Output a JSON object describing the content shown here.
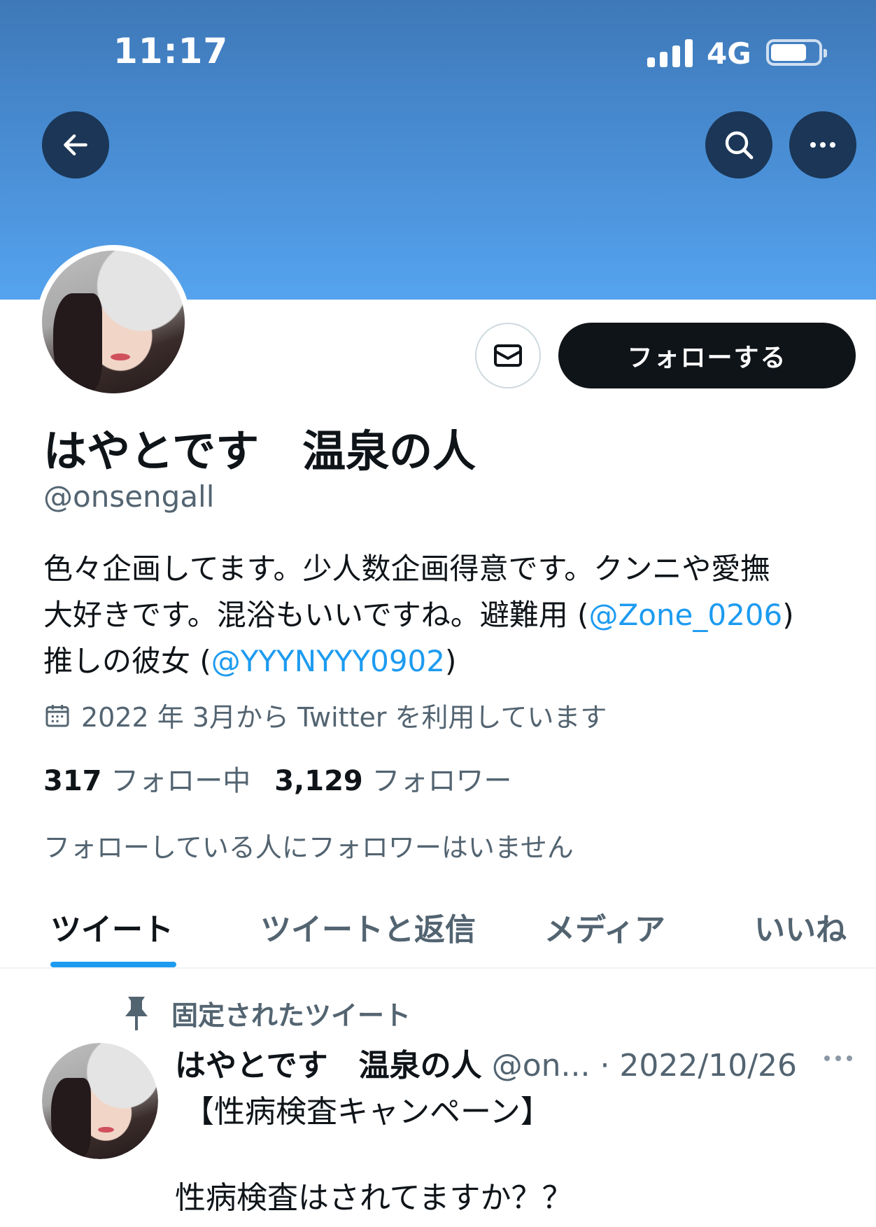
{
  "status_bar": {
    "time": "11:17",
    "network": "4G"
  },
  "header": {
    "back_icon": "arrow-left-icon",
    "search_icon": "search-icon",
    "more_icon": "more-horizontal-icon"
  },
  "profile": {
    "display_name": "はやとです　温泉の人",
    "handle": "@onsengall",
    "follow_label": "フォローする",
    "bio": {
      "line1": "色々企画してます。少人数企画得意です。クンニや愛撫",
      "line2_prefix": "大好きです。混浴もいいですね。避難用 (",
      "line2_link": "@Zone_0206",
      "line2_suffix": ")",
      "line3_prefix": "推しの彼女 (",
      "line3_link": "@YYYNYYY0902",
      "line3_suffix": ")"
    },
    "joined": "2022 年 3月から Twitter を利用しています",
    "following_count": "317",
    "following_label": "フォロー中",
    "followers_count": "3,129",
    "followers_label": "フォロワー",
    "no_mutual_followers": "フォローしている人にフォロワーはいません"
  },
  "tabs": [
    "ツイート",
    "ツイートと返信",
    "メディア",
    "いいね"
  ],
  "pinned_tweet": {
    "pinned_label": "固定されたツイート",
    "author_name": "はやとです　温泉の人",
    "author_handle_date": "@on... · 2022/10/26",
    "line1": "【性病検査キャンペーン】",
    "line2": "性病検査はされてますか？？"
  },
  "colors": {
    "accent": "#1d9bf0",
    "banner_top": "#3e78b8",
    "banner_bottom": "#55a3ee",
    "follow_button": "#0f1419"
  }
}
